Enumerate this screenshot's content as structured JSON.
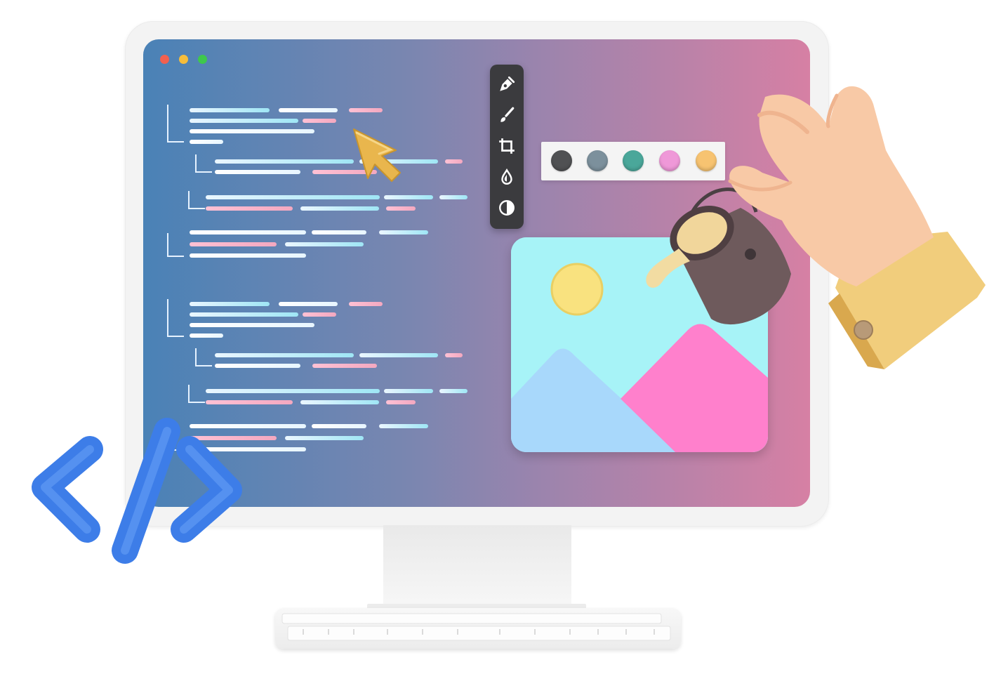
{
  "window": {
    "controls": [
      "window-close-dot",
      "window-minimize-dot",
      "window-maximize-dot"
    ],
    "control_colors": [
      "#f2604f",
      "#f6bd3b",
      "#3ec84c"
    ]
  },
  "editor": {
    "tools": [
      "pen-tool-icon",
      "brush-icon",
      "crop-icon",
      "drop-icon",
      "contrast-icon"
    ],
    "palette_colors": [
      "#505153",
      "#7c909c",
      "#4aa79a",
      "#ef98d8",
      "#f7c371"
    ]
  },
  "illustration": {
    "image_colors": {
      "sky": "#a7f3f7",
      "sun": "#f9e27f",
      "mountain_left": "#a8d8fb",
      "mountain_right": "#ff80cc"
    },
    "code_symbol_color": "#3d7de8"
  }
}
